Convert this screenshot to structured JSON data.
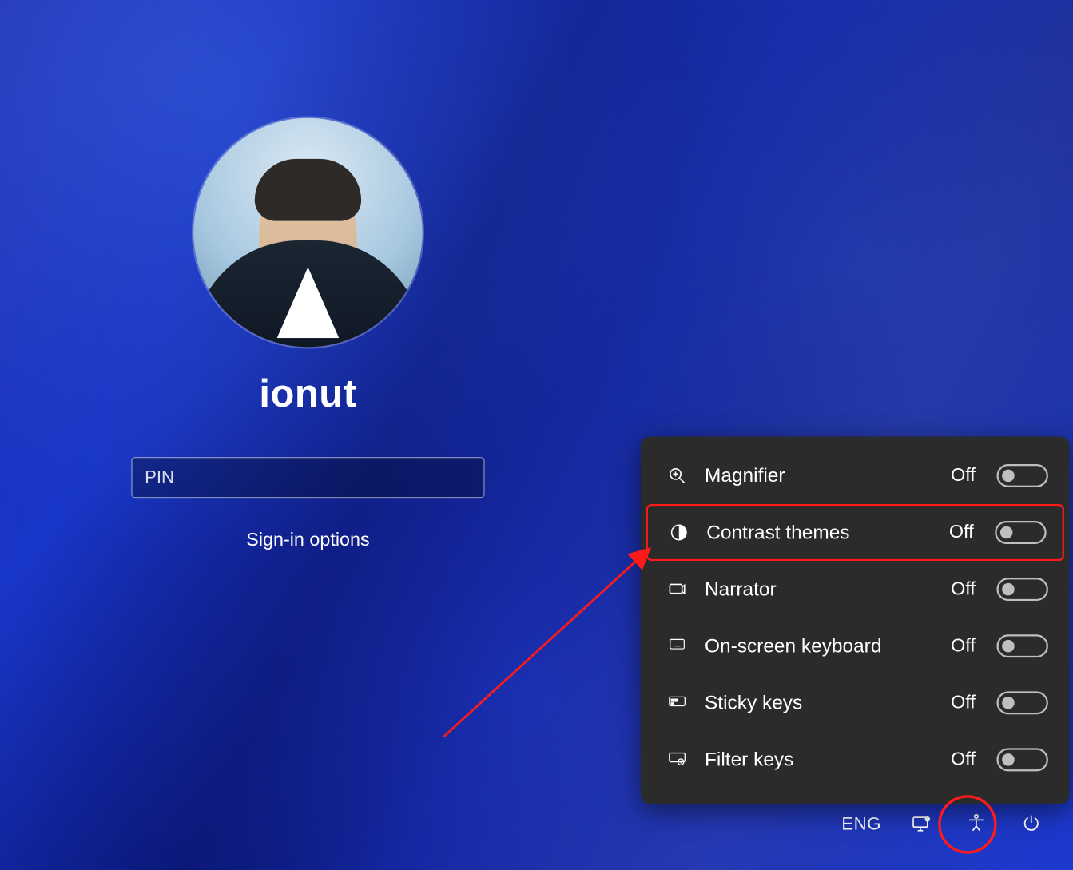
{
  "login": {
    "username": "ionut",
    "pin_placeholder": "PIN",
    "signin_options_label": "Sign-in options"
  },
  "accessibility_panel": {
    "highlight_index": 1,
    "items": [
      {
        "icon": "magnifier-icon",
        "label": "Magnifier",
        "state": "Off"
      },
      {
        "icon": "contrast-icon",
        "label": "Contrast themes",
        "state": "Off"
      },
      {
        "icon": "narrator-icon",
        "label": "Narrator",
        "state": "Off"
      },
      {
        "icon": "keyboard-icon",
        "label": "On-screen keyboard",
        "state": "Off"
      },
      {
        "icon": "sticky-keys-icon",
        "label": "Sticky keys",
        "state": "Off"
      },
      {
        "icon": "filter-keys-icon",
        "label": "Filter keys",
        "state": "Off"
      }
    ]
  },
  "tray": {
    "language": "ENG",
    "network_icon": "network-icon",
    "accessibility_icon": "accessibility-icon",
    "power_icon": "power-icon"
  },
  "annotation": {
    "arrow_color": "#ff1a1a",
    "circle_color": "#ff1a1a"
  }
}
